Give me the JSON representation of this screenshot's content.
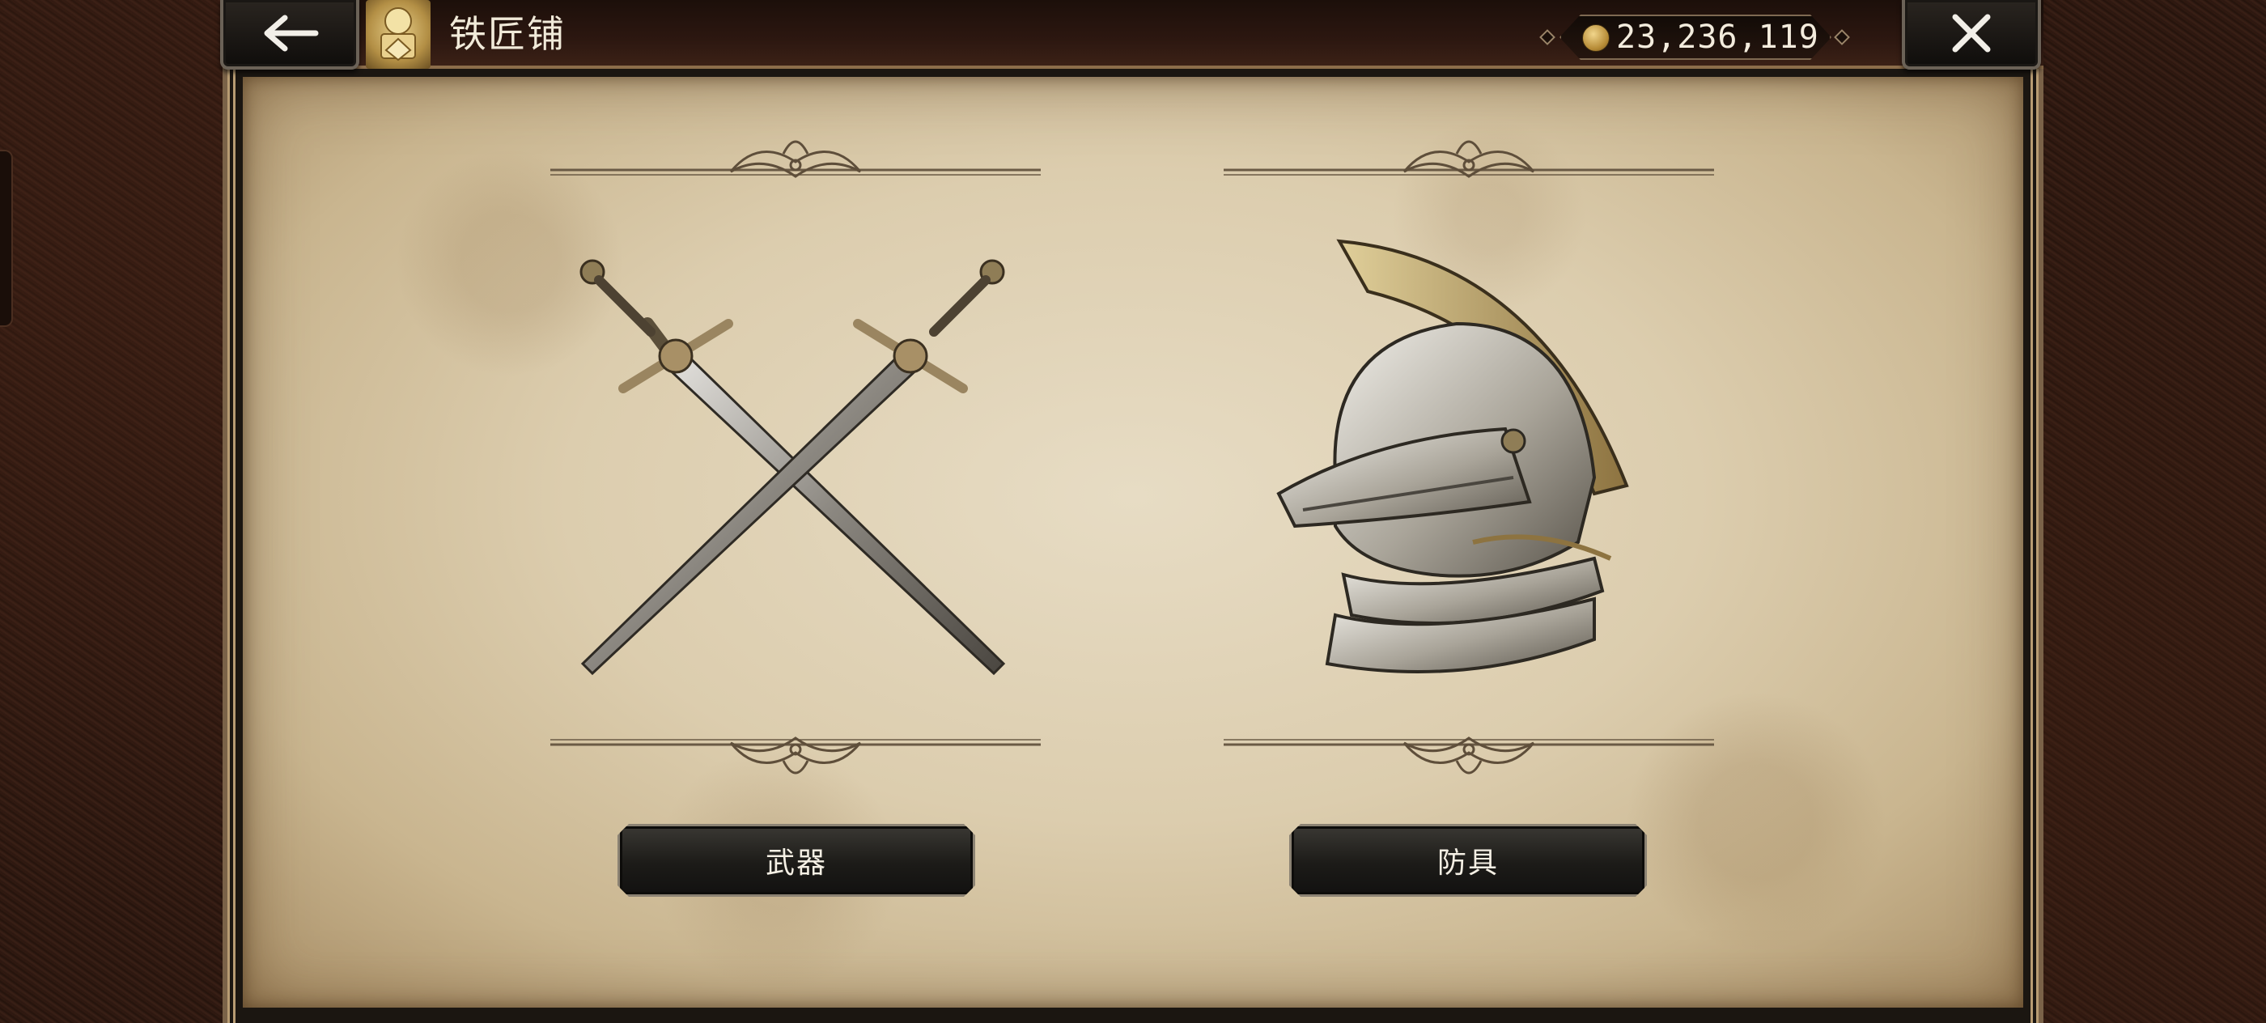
{
  "header": {
    "title": "铁匠铺",
    "currency_value": "23,236,119",
    "back_icon": "arrow-left-icon",
    "close_icon": "close-icon",
    "emblem_icon": "smith-emblem-icon",
    "coin_icon": "gold-coin-icon"
  },
  "categories": [
    {
      "label": "武器",
      "image": "crossed-swords-icon"
    },
    {
      "label": "防具",
      "image": "knight-helmet-icon"
    }
  ],
  "colors": {
    "parchment": "#dccdae",
    "button_bg": "#1c1b18",
    "button_text": "#f4efe4",
    "title_text": "#f1ead9",
    "gold": "#c9a352"
  }
}
